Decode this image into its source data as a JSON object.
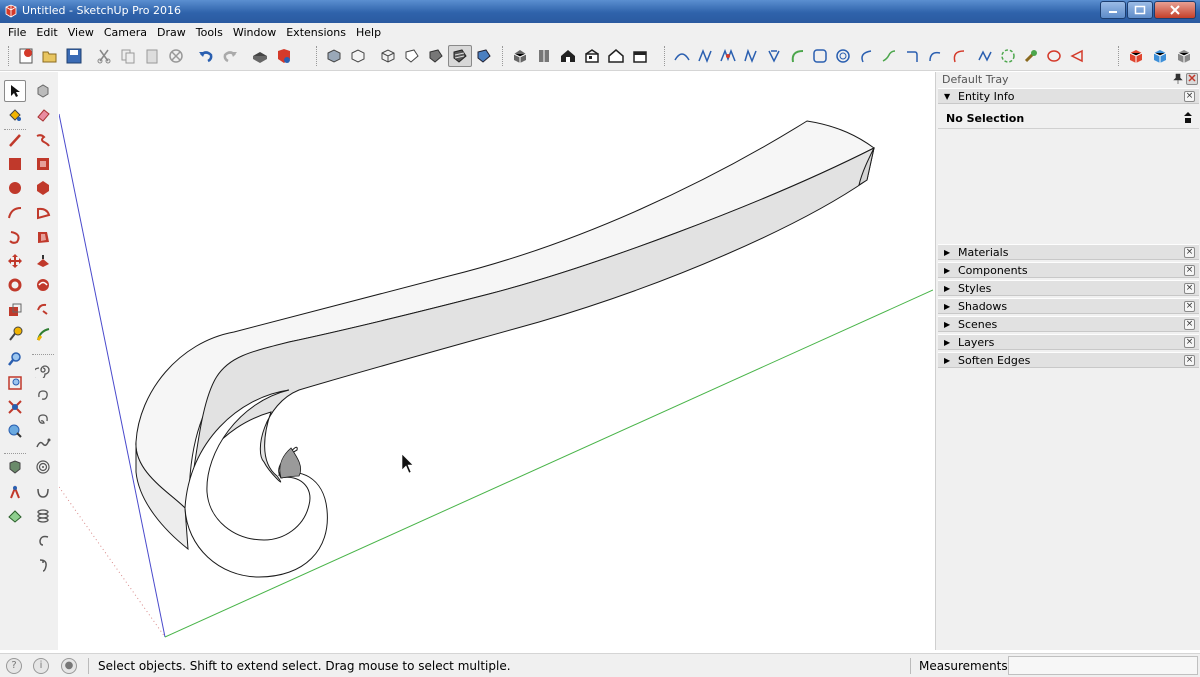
{
  "window": {
    "title": "Untitled - SketchUp Pro 2016",
    "controls": [
      "minimize-icon",
      "maximize-icon",
      "close-icon"
    ]
  },
  "menu": {
    "items": [
      "File",
      "Edit",
      "View",
      "Camera",
      "Draw",
      "Tools",
      "Window",
      "Extensions",
      "Help"
    ]
  },
  "toolbar": {
    "groups": [
      {
        "name": "standard",
        "icons": [
          "new-icon",
          "open-icon",
          "save-icon",
          "cut-icon",
          "copy-icon",
          "paste-icon",
          "erase-icon",
          "undo-icon",
          "redo-icon",
          "print-icon",
          "model-info-icon"
        ]
      },
      {
        "name": "face-style",
        "icons": [
          "xray-icon",
          "back-edges-icon",
          "wireframe-icon",
          "hidden-line-icon",
          "shaded-icon",
          "shaded-textures-icon",
          "monochrome-icon"
        ]
      },
      {
        "name": "views",
        "icons": [
          "iso-view-icon",
          "top-view-icon",
          "front-view-icon",
          "right-view-icon",
          "back-view-icon",
          "left-view-icon"
        ]
      },
      {
        "name": "bezier-curves",
        "icons": [
          "polyline-icon",
          "bezier-icon",
          "spline-icon",
          "cubic-bezier-icon",
          "b-spline-icon",
          "arc-curve-icon",
          "polygon-curve-icon",
          "circle-curve-icon",
          "arc-3pt-icon",
          "freehand-icon",
          "curve-fit-icon",
          "arc-bulge-icon",
          "ellipse-arc-icon",
          "divider-curve-icon",
          "fspline-icon",
          "settings-tool-icon",
          "oval-icon",
          "triangle-curve-icon"
        ]
      },
      {
        "name": "warehouse",
        "icons": [
          "3d-warehouse-icon",
          "share-model-icon",
          "extension-warehouse-icon"
        ]
      }
    ]
  },
  "left_tools": {
    "col1": [
      "select-icon",
      "paint-bucket-icon",
      "line-icon",
      "rectangle-icon",
      "circle-icon",
      "arc-icon",
      "rotated-arc-icon",
      "move-icon",
      "rotate-icon",
      "scale-icon",
      "tape-measure-icon",
      "zoom-icon",
      "zoom-window-icon",
      "zoom-extents-icon",
      "position-camera-icon",
      "walk-icon",
      "look-around-icon"
    ],
    "col2": [
      "make-component-icon",
      "eraser-icon",
      "freehand-icon",
      "rotated-rectangle-icon",
      "polygon-icon",
      "pie-icon",
      "push-pull-icon",
      "follow-me-icon",
      "offset-icon",
      "protractor-icon",
      "spiral-icon",
      "spiral-cw-icon",
      "spiral-ccw-icon",
      "helix-icon",
      "spiral-flat-icon",
      "spiral-up-icon",
      "spring-icon",
      "curl-icon",
      "hook-icon"
    ]
  },
  "tray": {
    "title": "Default Tray",
    "entity_info": {
      "label": "Entity Info",
      "selection": "No Selection"
    },
    "panels": [
      "Materials",
      "Components",
      "Styles",
      "Shadows",
      "Scenes",
      "Layers",
      "Soften Edges"
    ]
  },
  "status": {
    "message": "Select objects. Shift to extend select. Drag mouse to select multiple.",
    "measurements_label": "Measurements",
    "measurements_value": ""
  },
  "colors": {
    "title_bar": "#2f63ab",
    "blue_axis": "#4a4acc",
    "green_axis": "#49b449",
    "model_fill": "#f4f4f4"
  }
}
